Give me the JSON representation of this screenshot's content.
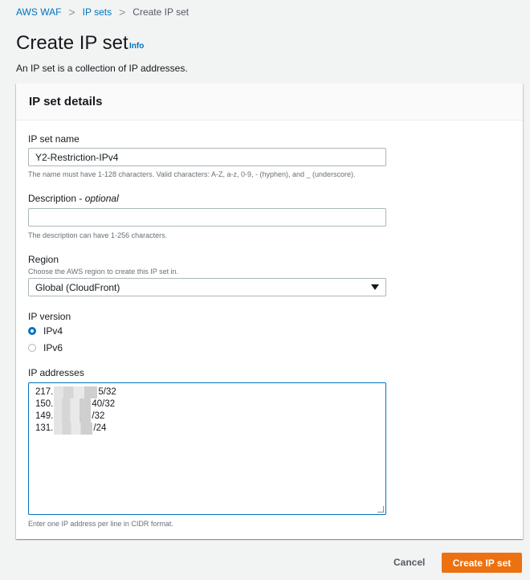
{
  "breadcrumb": {
    "items": [
      {
        "label": "AWS WAF"
      },
      {
        "label": "IP sets"
      },
      {
        "label": "Create IP set"
      }
    ],
    "separator": ">"
  },
  "page": {
    "title": "Create IP set",
    "info_label": "Info",
    "description": "An IP set is a collection of IP addresses."
  },
  "panel": {
    "title": "IP set details",
    "name_field": {
      "label": "IP set name",
      "value": "Y2-Restriction-IPv4",
      "hint": "The name must have 1-128 characters. Valid characters: A-Z, a-z, 0-9, - (hyphen), and _ (underscore)."
    },
    "description_field": {
      "label": "Description",
      "label_suffix": "optional",
      "label_dash": " - ",
      "value": "",
      "hint": "The description can have 1-256 characters."
    },
    "region_field": {
      "label": "Region",
      "hint": "Choose the AWS region to create this IP set in.",
      "selected": "Global (CloudFront)"
    },
    "ip_version": {
      "label": "IP version",
      "options": [
        {
          "label": "IPv4",
          "checked": true
        },
        {
          "label": "IPv6",
          "checked": false
        }
      ]
    },
    "ip_addresses": {
      "label": "IP addresses",
      "lines": [
        {
          "prefix": "217.",
          "suffix": "5/32"
        },
        {
          "prefix": "150.",
          "suffix": "40/32"
        },
        {
          "prefix": "149.",
          "suffix": "/32"
        },
        {
          "prefix": "131.",
          "suffix": "/24"
        }
      ],
      "hint": "Enter one IP address per line in CIDR format."
    }
  },
  "footer": {
    "cancel_label": "Cancel",
    "create_label": "Create IP set"
  },
  "colors": {
    "link": "#0073bb",
    "primary_button": "#ec7211",
    "background": "#f2f3f3"
  }
}
